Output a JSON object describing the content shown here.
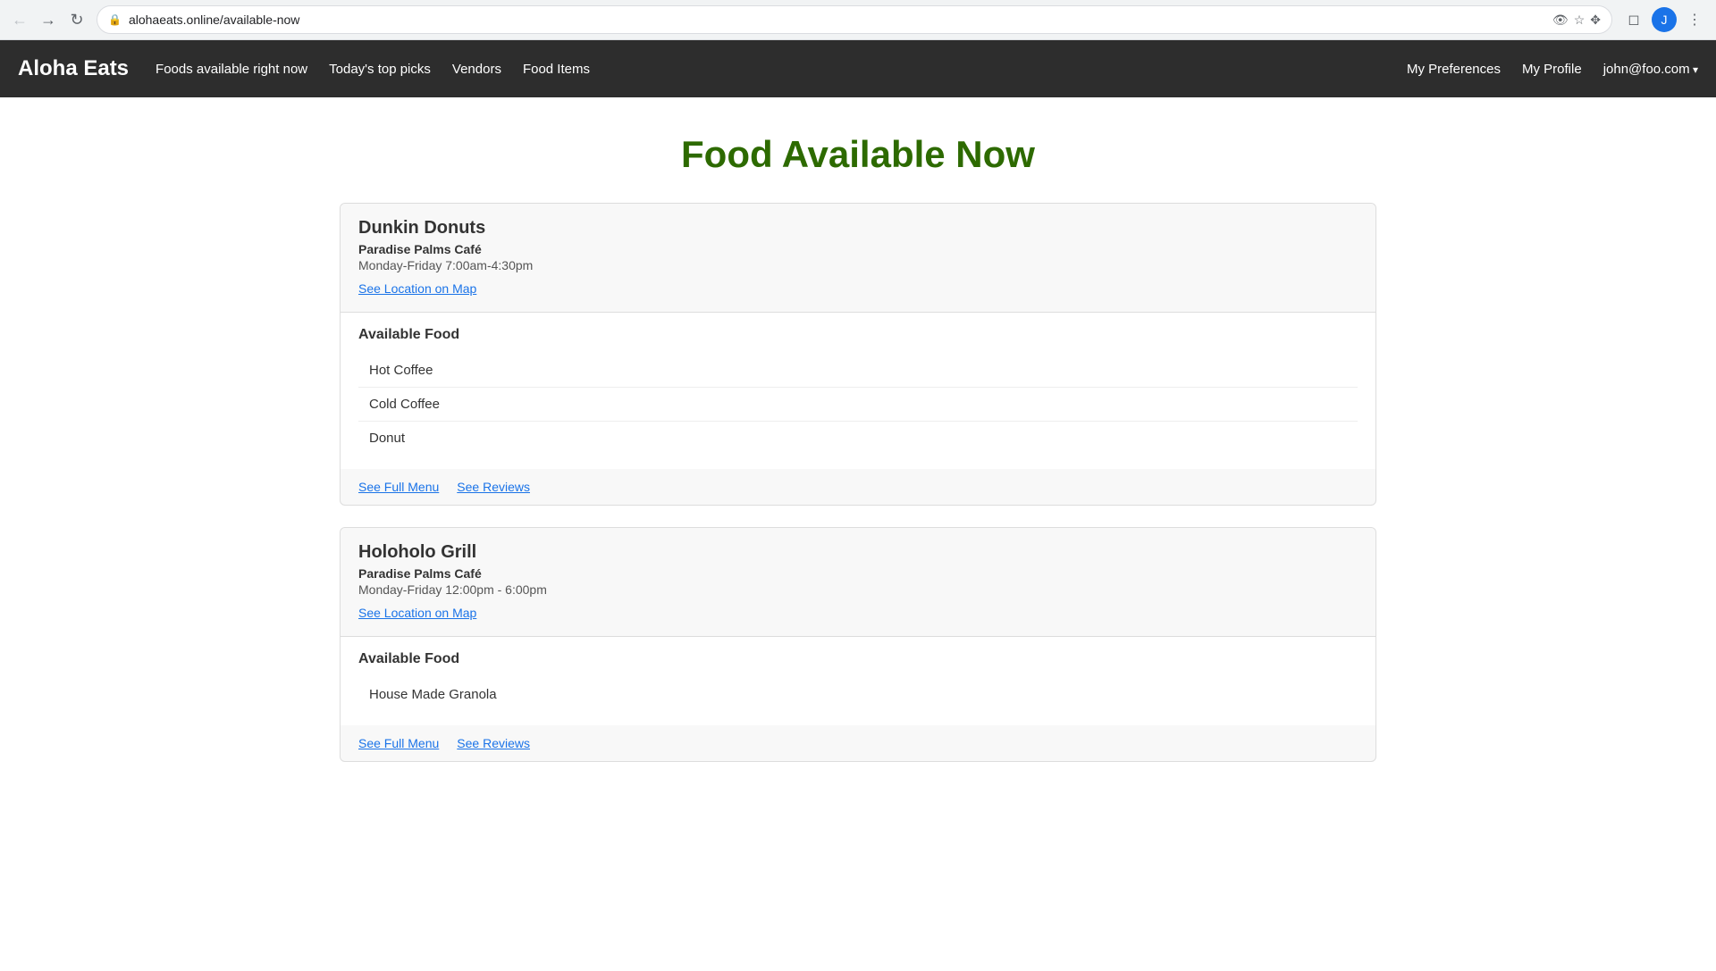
{
  "browser": {
    "url": "alohaeats.online/available-now",
    "nav_back_label": "←",
    "nav_forward_label": "→",
    "nav_refresh_label": "↻",
    "avatar_letter": "J",
    "extensions_icon": "⊞",
    "star_icon": "☆",
    "menu_icon": "⋮"
  },
  "navbar": {
    "brand": "Aloha Eats",
    "links": [
      {
        "label": "Foods available right now",
        "key": "available-now"
      },
      {
        "label": "Today's top picks",
        "key": "top-picks"
      },
      {
        "label": "Vendors",
        "key": "vendors"
      },
      {
        "label": "Food Items",
        "key": "food-items"
      }
    ],
    "right_links": [
      {
        "label": "My Preferences",
        "key": "preferences"
      },
      {
        "label": "My Profile",
        "key": "profile"
      },
      {
        "label": "john@foo.com",
        "key": "account",
        "has_arrow": true
      }
    ]
  },
  "page": {
    "title": "Food Available Now"
  },
  "restaurants": [
    {
      "id": "dunkin-donuts",
      "name": "Dunkin Donuts",
      "location": "Paradise Palms Café",
      "hours": "Monday-Friday 7:00am-4:30pm",
      "map_link_label": "See Location on Map",
      "available_food_title": "Available Food",
      "food_items": [
        {
          "name": "Hot Coffee"
        },
        {
          "name": "Cold Coffee"
        },
        {
          "name": "Donut"
        }
      ],
      "full_menu_label": "See Full Menu",
      "reviews_label": "See Reviews"
    },
    {
      "id": "holoholo-grill",
      "name": "Holoholo Grill",
      "location": "Paradise Palms Café",
      "hours": "Monday-Friday 12:00pm - 6:00pm",
      "map_link_label": "See Location on Map",
      "available_food_title": "Available Food",
      "food_items": [
        {
          "name": "House Made Granola"
        }
      ],
      "full_menu_label": "See Full Menu",
      "reviews_label": "See Reviews"
    }
  ]
}
